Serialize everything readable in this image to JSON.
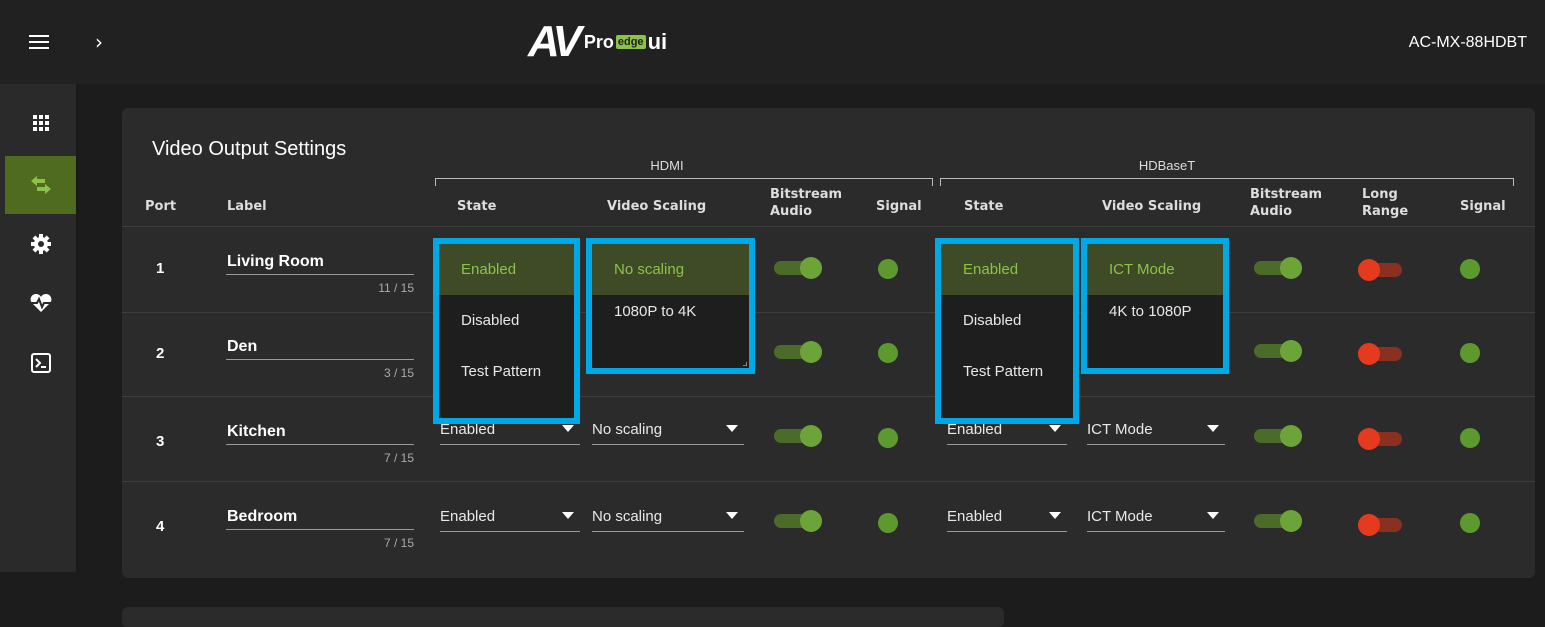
{
  "header": {
    "logo_av": "AV",
    "logo_pro": "Pro",
    "logo_edge": "edge",
    "logo_ui": "ui",
    "device_name": "AC-MX-88HDBT"
  },
  "sidebar": {
    "items": [
      {
        "icon": "grid-icon"
      },
      {
        "icon": "swap-arrows-icon",
        "active": true
      },
      {
        "icon": "gear-icon"
      },
      {
        "icon": "heart-pulse-icon"
      },
      {
        "icon": "terminal-icon"
      }
    ]
  },
  "panel": {
    "title": "Video Output Settings",
    "groups": {
      "hdmi": "HDMI",
      "hdbaset": "HDBaseT"
    },
    "headers": {
      "port": "Port",
      "label": "Label",
      "hdmi_state": "State",
      "hdmi_scaling": "Video Scaling",
      "hdmi_bitstream_1": "Bitstream",
      "hdmi_bitstream_2": "Audio",
      "hdmi_signal": "Signal",
      "hdb_state": "State",
      "hdb_scaling": "Video Scaling",
      "hdb_bitstream_1": "Bitstream",
      "hdb_bitstream_2": "Audio",
      "hdb_long_1": "Long",
      "hdb_long_2": "Range",
      "hdb_signal": "Signal"
    },
    "rows": [
      {
        "port": "1",
        "label": "Living Room",
        "count": "11 / 15",
        "hdmi_state": "Enabled",
        "hdmi_scaling": "No scaling",
        "hdb_state": "Enabled",
        "hdb_scaling": "ICT Mode"
      },
      {
        "port": "2",
        "label": "Den",
        "count": "3 / 15",
        "hdmi_state": "Enabled",
        "hdmi_scaling": "No scaling",
        "hdb_state": "Enabled",
        "hdb_scaling": "ICT Mode"
      },
      {
        "port": "3",
        "label": "Kitchen",
        "count": "7 / 15",
        "hdmi_state": "Enabled",
        "hdmi_scaling": "No scaling",
        "hdb_state": "Enabled",
        "hdb_scaling": "ICT Mode"
      },
      {
        "port": "4",
        "label": "Bedroom",
        "count": "7 / 15",
        "hdmi_state": "Enabled",
        "hdmi_scaling": "No scaling",
        "hdb_state": "Enabled",
        "hdb_scaling": "ICT Mode"
      }
    ],
    "dropdowns": {
      "hdmi_state_options": [
        "Enabled",
        "Disabled",
        "Test Pattern"
      ],
      "hdmi_scaling_options": [
        "No scaling",
        "1080P to 4K"
      ],
      "hdb_state_options": [
        "Enabled",
        "Disabled",
        "Test Pattern"
      ],
      "hdb_scaling_options": [
        "ICT Mode",
        "4K to 1080P"
      ]
    }
  },
  "colors": {
    "accent_green": "#8bc34a",
    "highlight_blue": "#00a8e6",
    "toggle_red": "#e53a1e",
    "signal_green": "#5c9a2f"
  }
}
